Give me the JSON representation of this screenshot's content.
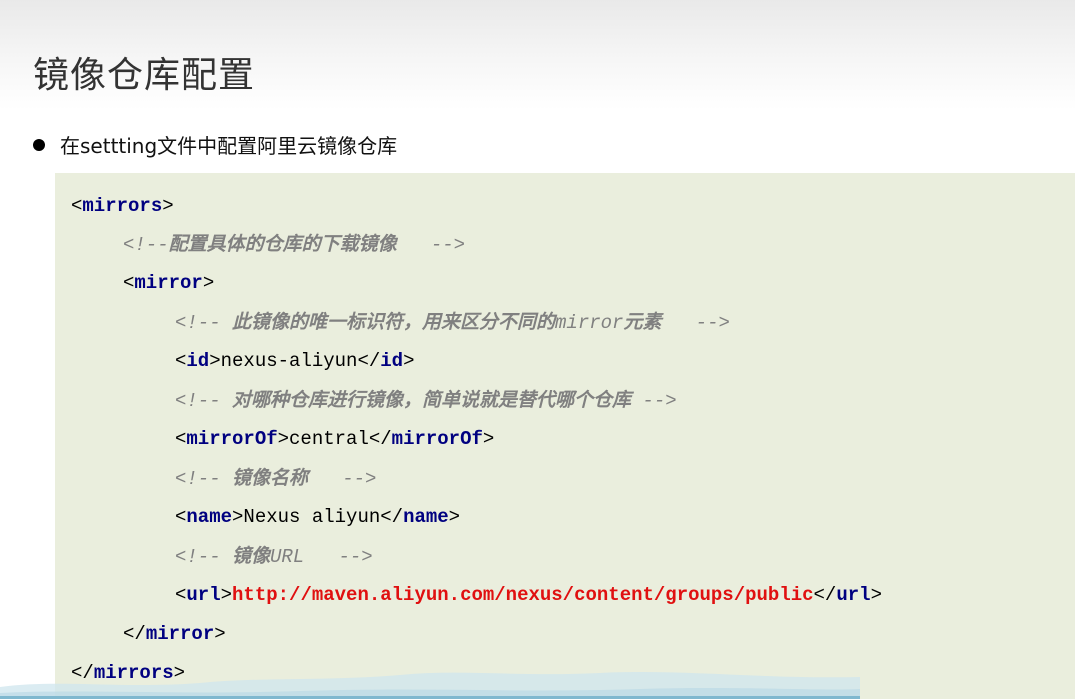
{
  "slide": {
    "title": "镜像仓库配置",
    "bullet": "在settting文件中配置阿里云镜像仓库"
  },
  "code": {
    "mirrors_open_tag": "mirrors",
    "comment1": "配置具体的仓库的下载镜像",
    "mirror_open_tag": "mirror",
    "comment2_cjk": "此镜像的唯一标识符，用来区分不同的",
    "comment2_mono": "mirror",
    "comment2_cjk_tail": "元素",
    "id_tag": "id",
    "id_value": "nexus-aliyun",
    "comment3": "对哪种仓库进行镜像，简单说就是替代哪个仓库",
    "mirrorOf_tag": "mirrorOf",
    "mirrorOf_value": "central",
    "comment4": "镜像名称",
    "name_tag": "name",
    "name_value": "Nexus aliyun",
    "comment5_cjk": "镜像",
    "comment5_mono": "URL",
    "url_tag": "url",
    "url_value": "http://maven.aliyun.com/nexus/content/groups/public",
    "mirror_close_tag": "mirror",
    "mirrors_close_tag": "mirrors"
  },
  "colors": {
    "code_background": "#eaeedd",
    "tag": "#000080",
    "comment": "#808080",
    "url_value": "#e01010"
  }
}
